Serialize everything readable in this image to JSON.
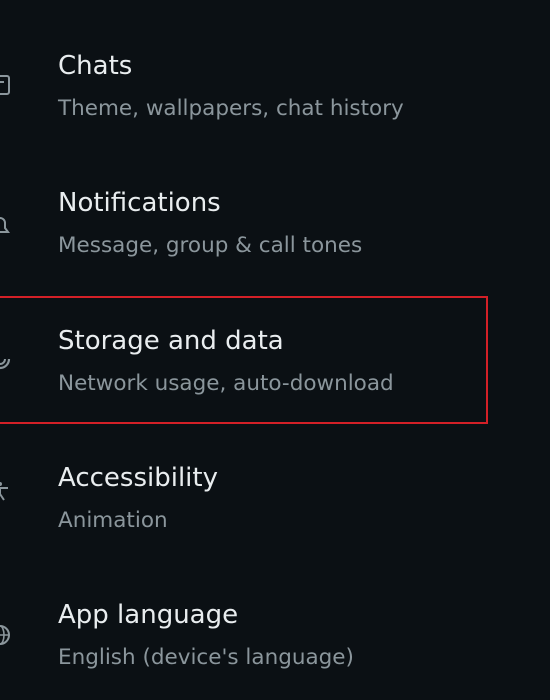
{
  "settings": {
    "items": [
      {
        "title": "Chats",
        "subtitle": "Theme, wallpapers, chat history",
        "icon": "chat-icon"
      },
      {
        "title": "Notifications",
        "subtitle": "Message, group & call tones",
        "icon": "bell-icon"
      },
      {
        "title": "Storage and data",
        "subtitle": "Network usage, auto-download",
        "icon": "storage-icon"
      },
      {
        "title": "Accessibility",
        "subtitle": "Animation",
        "icon": "accessibility-icon"
      },
      {
        "title": "App language",
        "subtitle": "English (device's language)",
        "icon": "globe-icon"
      }
    ]
  },
  "colors": {
    "background": "#0b1014",
    "title": "#e9edef",
    "subtitle": "#8b969c",
    "highlight": "#d32027"
  }
}
